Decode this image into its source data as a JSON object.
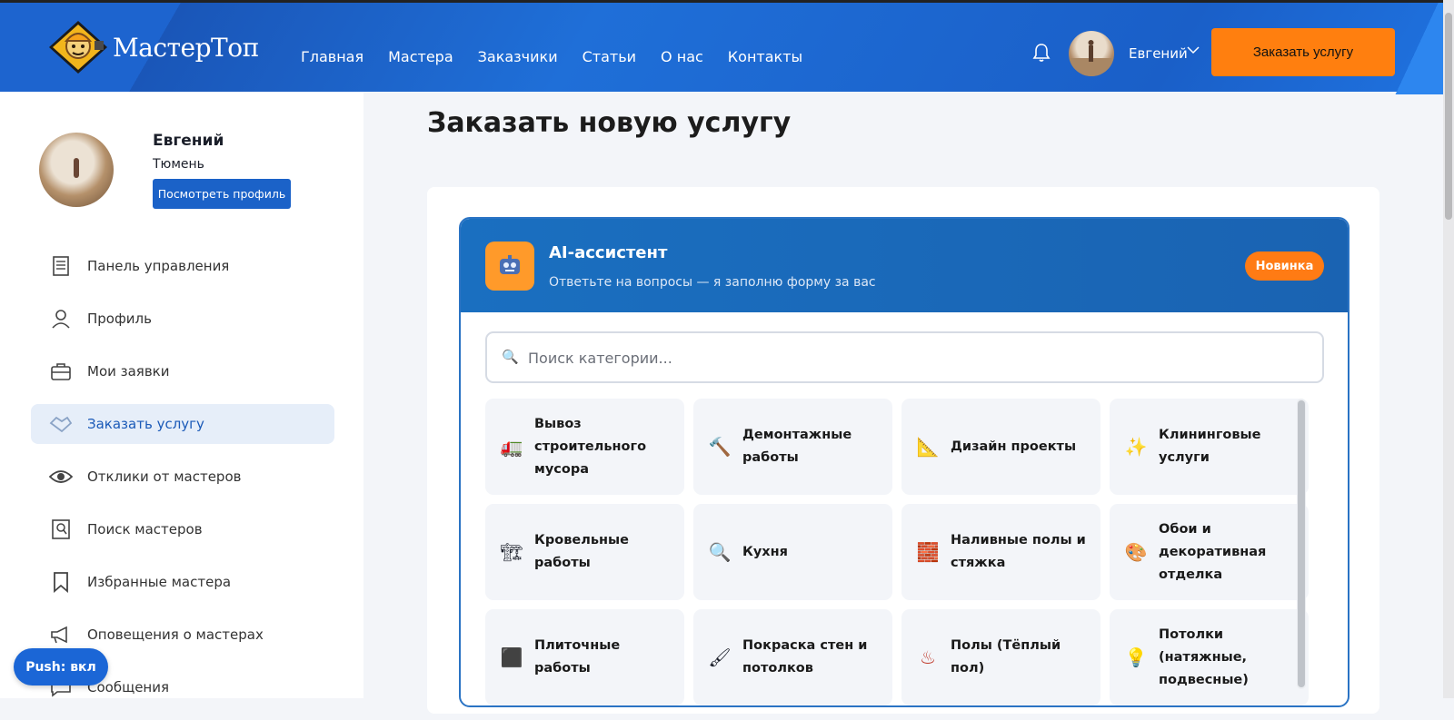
{
  "header": {
    "logo_text": "МастерТоп",
    "nav": [
      "Главная",
      "Мастера",
      "Заказчики",
      "Статьи",
      "О нас",
      "Контакты"
    ],
    "user_name": "Евгений",
    "order_button": "Заказать услугу"
  },
  "sidebar": {
    "name": "Евгений",
    "city": "Тюмень",
    "view_profile": "Посмотреть профиль",
    "items": [
      {
        "label": "Панель управления",
        "icon": "document-icon"
      },
      {
        "label": "Профиль",
        "icon": "user-icon"
      },
      {
        "label": "Мои заявки",
        "icon": "briefcase-icon"
      },
      {
        "label": "Заказать услугу",
        "icon": "handshake-icon",
        "active": true
      },
      {
        "label": "Отклики от мастеров",
        "icon": "eye-icon"
      },
      {
        "label": "Поиск мастеров",
        "icon": "search-user-icon"
      },
      {
        "label": "Избранные мастера",
        "icon": "bookmark-icon"
      },
      {
        "label": "Оповещения о мастерах",
        "icon": "megaphone-icon"
      },
      {
        "label": "Сообщения",
        "icon": "chat-icon"
      }
    ],
    "push_label": "Push: вкл"
  },
  "main": {
    "title": "Заказать новую услугу",
    "ai": {
      "title": "AI-ассистент",
      "subtitle": "Ответьте на вопросы — я заполню форму за вас",
      "badge": "Новинка"
    },
    "search_placeholder": "Поиск категории...",
    "categories": [
      {
        "label": "Вывоз строительного мусора",
        "icon": "🚛"
      },
      {
        "label": "Демонтажные работы",
        "icon": "🔨"
      },
      {
        "label": "Дизайн проекты",
        "icon": "📐"
      },
      {
        "label": "Клининговые услуги",
        "icon": "✨"
      },
      {
        "label": "Кровельные работы",
        "icon": "🏗"
      },
      {
        "label": "Кухня",
        "icon": "🔍"
      },
      {
        "label": "Наливные полы и стяжка",
        "icon": "🧱"
      },
      {
        "label": "Обои и декоративная отделка",
        "icon": "🎨"
      },
      {
        "label": "Плиточные работы",
        "icon": "⬛"
      },
      {
        "label": "Покраска стен и потолков",
        "icon": "🖌"
      },
      {
        "label": "Полы (Тёплый пол)",
        "icon": "♨"
      },
      {
        "label": "Потолки (натяжные, подвесные)",
        "icon": "💡"
      }
    ]
  },
  "colors": {
    "header_blue": "#1d64cf",
    "accent_orange": "#ff7f0f",
    "primary_blue": "#1b62c8"
  }
}
